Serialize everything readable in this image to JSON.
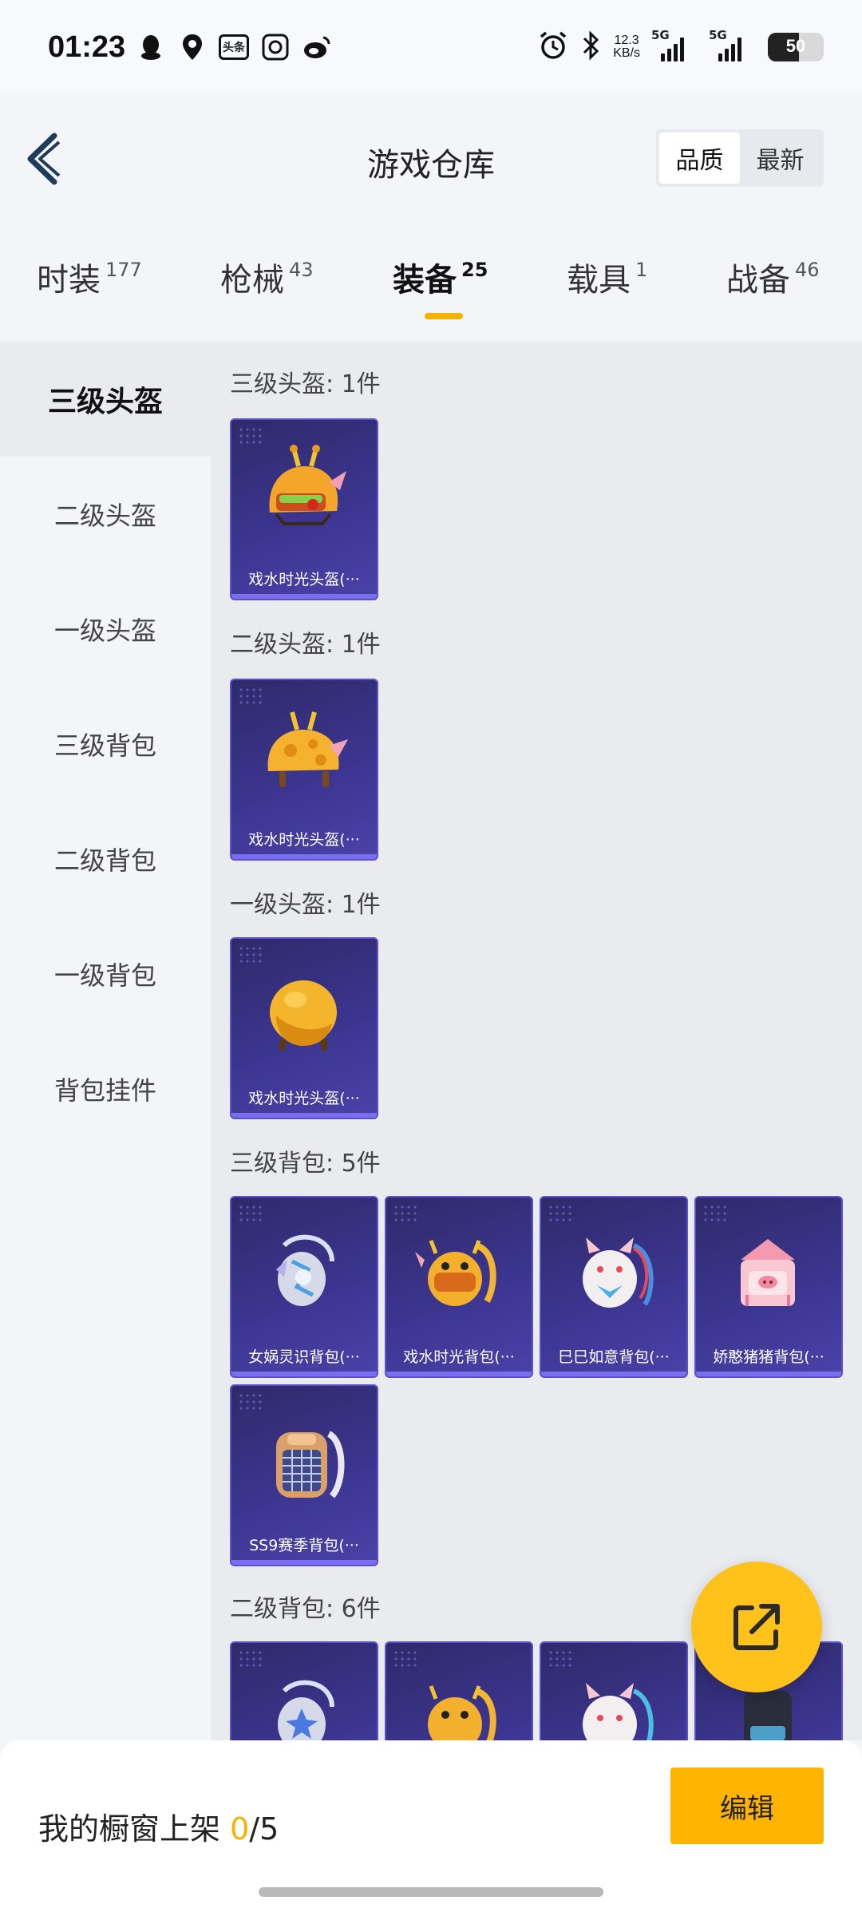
{
  "status_bar": {
    "time": "01:23",
    "left_icons": [
      "qq-icon",
      "location-pin-icon",
      "toutiao-icon",
      "du-app-icon",
      "weibo-icon"
    ],
    "toutiao_label": "头条",
    "net_speed_value": "12.3",
    "net_speed_unit": "KB/s",
    "signal1_label": "5G",
    "signal2_label": "5G",
    "battery": "50"
  },
  "header": {
    "title": "游戏仓库",
    "sort_options": [
      "品质",
      "最新"
    ],
    "sort_selected": "品质"
  },
  "tabs": [
    {
      "label": "时装",
      "count": "177"
    },
    {
      "label": "枪械",
      "count": "43"
    },
    {
      "label": "装备",
      "count": "25",
      "active": true
    },
    {
      "label": "载具",
      "count": "1"
    },
    {
      "label": "战备",
      "count": "46"
    }
  ],
  "categories": [
    "三级头盔",
    "二级头盔",
    "一级头盔",
    "三级背包",
    "二级背包",
    "一级背包",
    "背包挂件"
  ],
  "selected_category": "三级头盔",
  "sections": [
    {
      "title": "三级头盔: 1件",
      "items": [
        {
          "name": "戏水时光头盔(···",
          "icon": "helmet-icon"
        }
      ]
    },
    {
      "title": "二级头盔: 1件",
      "items": [
        {
          "name": "戏水时光头盔(···",
          "icon": "helmet-icon"
        }
      ]
    },
    {
      "title": "一级头盔: 1件",
      "items": [
        {
          "name": "戏水时光头盔(···",
          "icon": "helmet-icon"
        }
      ]
    },
    {
      "title": "三级背包: 5件",
      "items": [
        {
          "name": "女娲灵识背包(···",
          "icon": "backpack-icon"
        },
        {
          "name": "戏水时光背包(···",
          "icon": "backpack-icon"
        },
        {
          "name": "巳巳如意背包(···",
          "icon": "backpack-icon"
        },
        {
          "name": "娇憨猪猪背包(···",
          "icon": "backpack-icon"
        },
        {
          "name": "SS9赛季背包(···",
          "icon": "backpack-icon"
        }
      ]
    },
    {
      "title": "二级背包: 6件",
      "items": [
        {
          "name": "",
          "icon": "backpack-icon"
        },
        {
          "name": "",
          "icon": "backpack-icon"
        },
        {
          "name": "",
          "icon": "backpack-icon"
        },
        {
          "name": "",
          "icon": "backpack-icon"
        }
      ]
    }
  ],
  "bottom": {
    "window_label_prefix": "我的橱窗上架 ",
    "window_count": "0",
    "window_total": "/5",
    "edit_label": "编辑"
  },
  "colors": {
    "accent": "#f5b300",
    "card_bg": "#3c3590",
    "fab": "#ffc21a"
  }
}
